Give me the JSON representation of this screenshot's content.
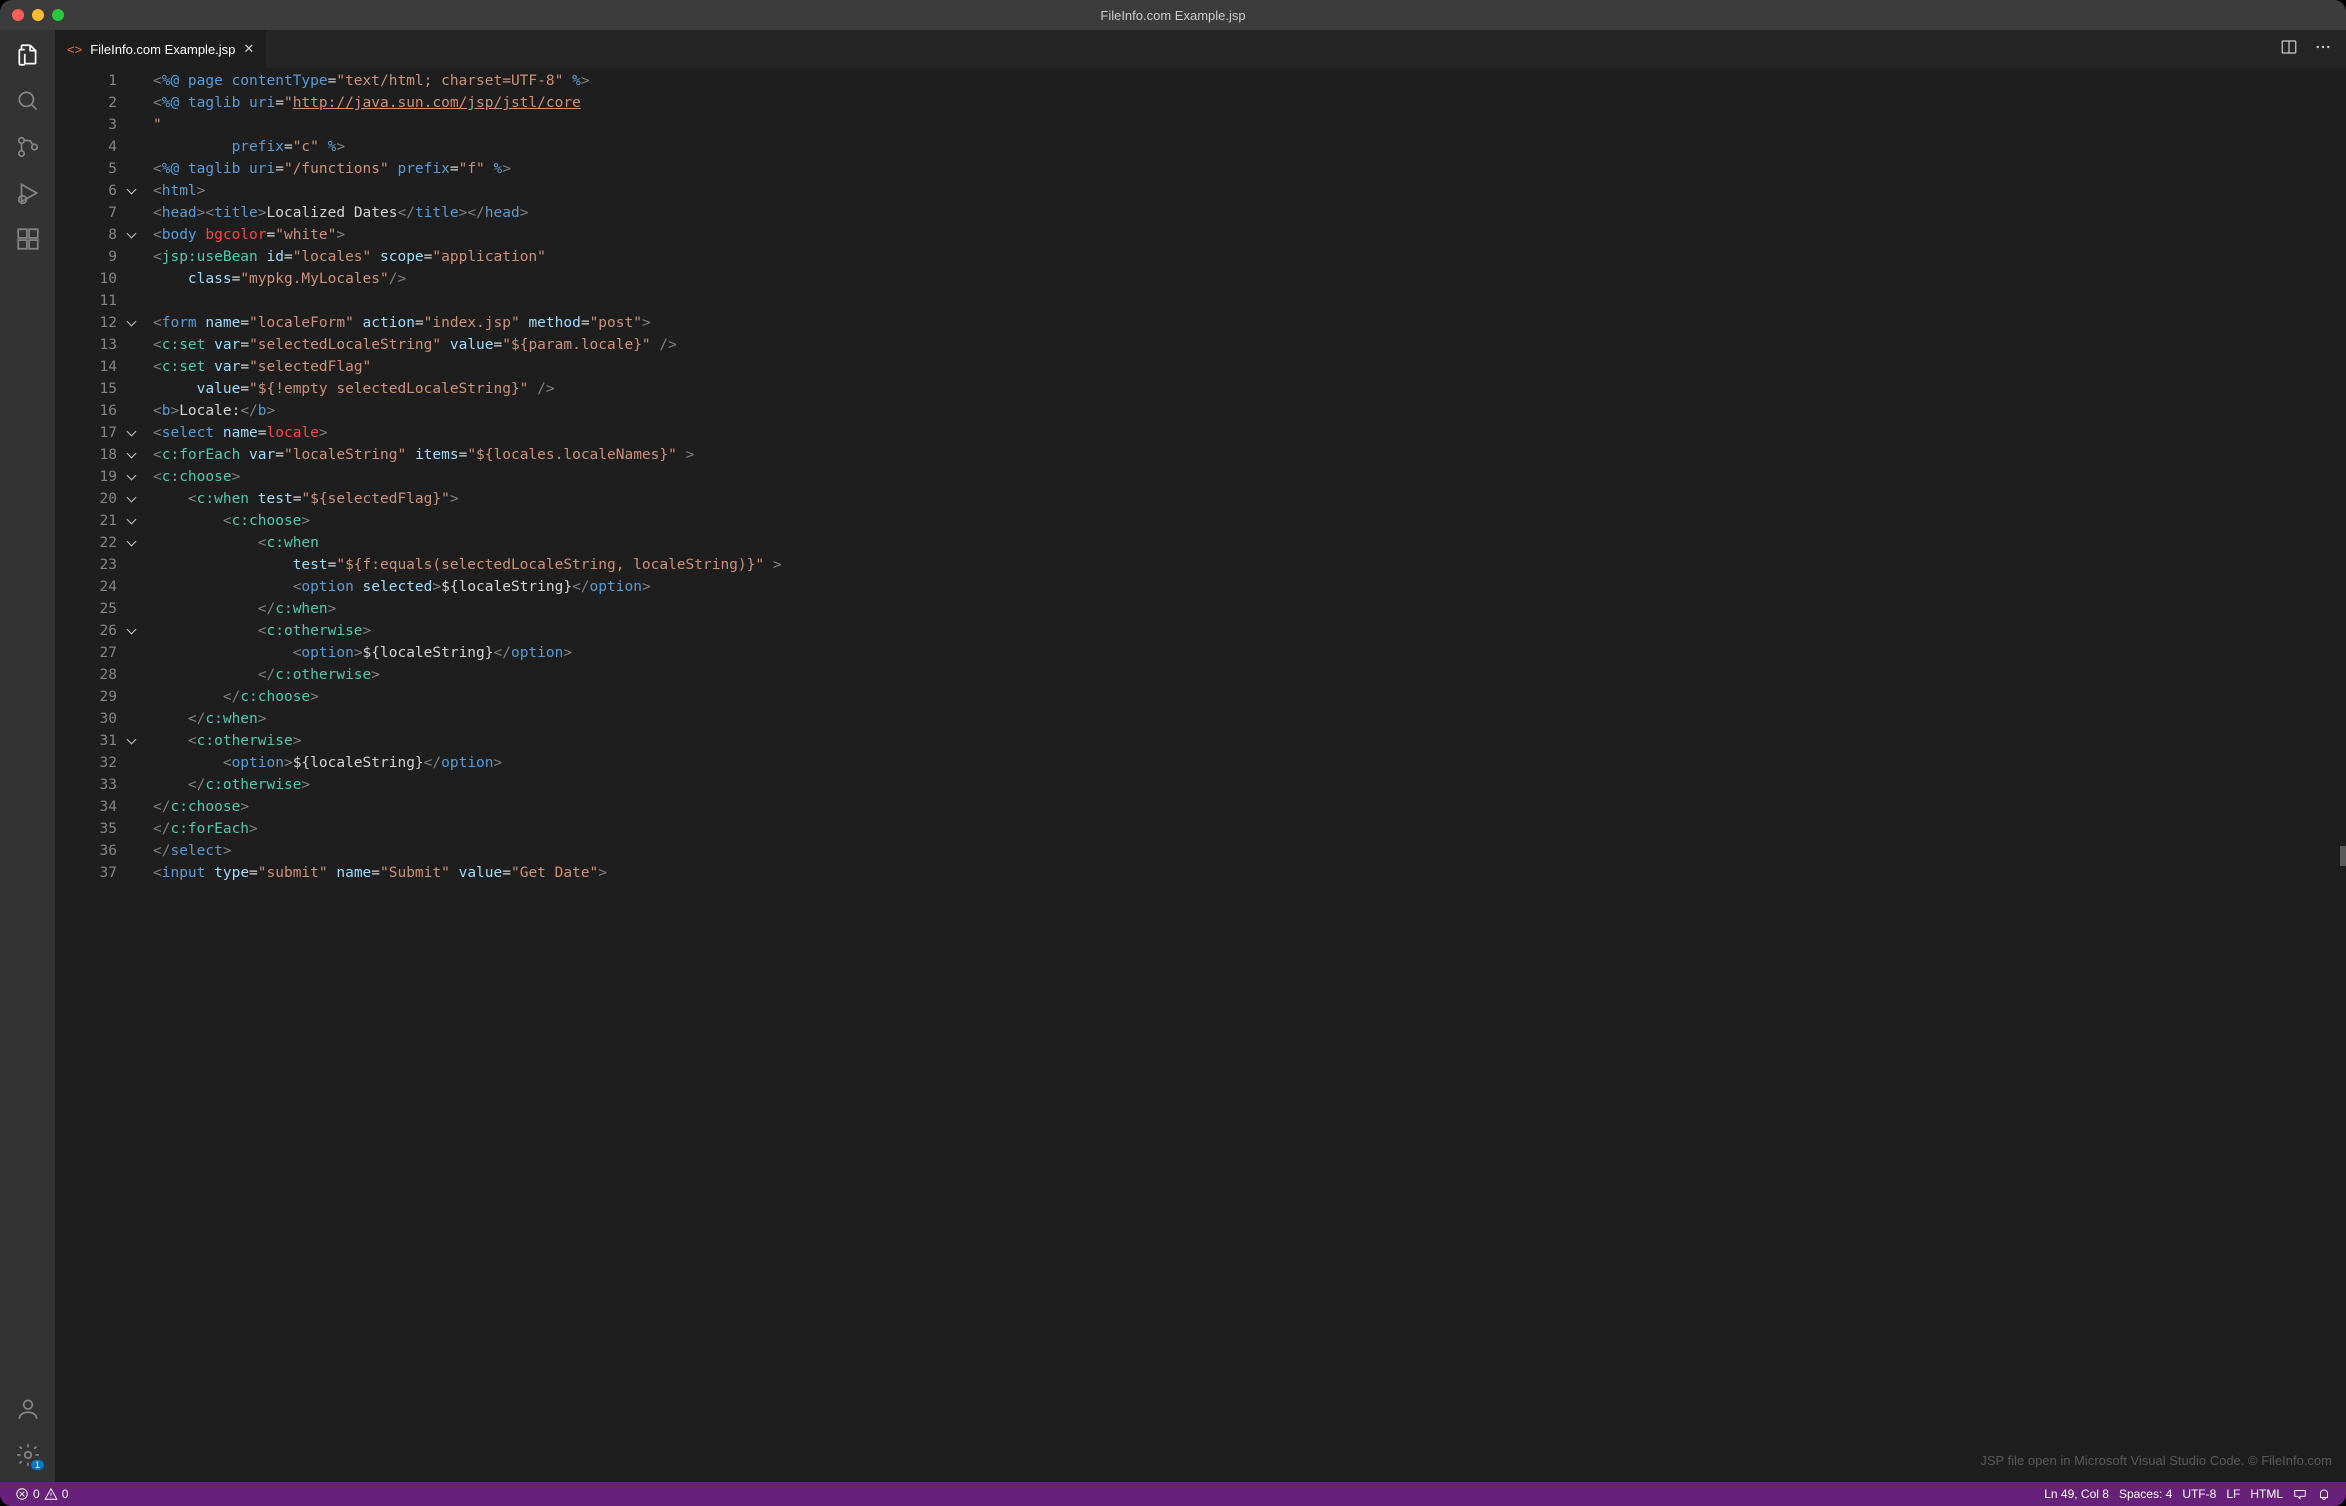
{
  "window": {
    "title": "FileInfo.com Example.jsp"
  },
  "tab": {
    "icon": "<>",
    "label": "FileInfo.com Example.jsp"
  },
  "watermark": "JSP file open in Microsoft Visual Studio Code. © FileInfo.com",
  "status": {
    "errors": "0",
    "warnings": "0",
    "cursor": "Ln 49, Col 8",
    "indent": "Spaces: 4",
    "encoding": "UTF-8",
    "eol": "LF",
    "language": "HTML"
  },
  "settingsBadge": "1",
  "lines": [
    {
      "n": 1,
      "fold": "",
      "html": "<span class='p-gray'>&lt;</span><span class='p-blue'>%@ page contentType</span><span class='p-white'>=</span><span class='p-brown'>\"text/html; charset=UTF-8\"</span> <span class='p-blue'>%</span><span class='p-gray'>&gt;</span>"
    },
    {
      "n": 2,
      "fold": "",
      "html": "<span class='p-gray'>&lt;</span><span class='p-blue'>%@ taglib uri</span><span class='p-white'>=</span><span class='p-brown'>\"<span class='p-under'>http://java.sun.com/jsp/jstl/core</span></span>"
    },
    {
      "n": 3,
      "fold": "",
      "html": "<span class='p-brown'>\"</span>"
    },
    {
      "n": 4,
      "fold": "",
      "html": "         <span class='p-blue'>prefix</span><span class='p-white'>=</span><span class='p-brown'>\"c\"</span> <span class='p-blue'>%</span><span class='p-gray'>&gt;</span>"
    },
    {
      "n": 5,
      "fold": "",
      "html": "<span class='p-gray'>&lt;</span><span class='p-blue'>%@ taglib uri</span><span class='p-white'>=</span><span class='p-brown'>\"/functions\"</span> <span class='p-blue'>prefix</span><span class='p-white'>=</span><span class='p-brown'>\"f\"</span> <span class='p-blue'>%</span><span class='p-gray'>&gt;</span>"
    },
    {
      "n": 6,
      "fold": "v",
      "html": "<span class='p-gray'>&lt;</span><span class='p-blue'>html</span><span class='p-gray'>&gt;</span>"
    },
    {
      "n": 7,
      "fold": "",
      "html": "<span class='p-gray'>&lt;</span><span class='p-blue'>head</span><span class='p-gray'>&gt;&lt;</span><span class='p-blue'>title</span><span class='p-gray'>&gt;</span><span class='p-white'>Localized Dates</span><span class='p-gray'>&lt;/</span><span class='p-blue'>title</span><span class='p-gray'>&gt;&lt;/</span><span class='p-blue'>head</span><span class='p-gray'>&gt;</span>"
    },
    {
      "n": 8,
      "fold": "v",
      "html": "<span class='p-gray'>&lt;</span><span class='p-blue'>body</span> <span class='p-red'>bgcolor</span><span class='p-white'>=</span><span class='p-brown'>\"white\"</span><span class='p-gray'>&gt;</span>"
    },
    {
      "n": 9,
      "fold": "",
      "html": "<span class='p-gray'>&lt;</span><span class='p-teal'>jsp:useBean</span> <span class='p-lightblue'>id</span><span class='p-white'>=</span><span class='p-brown'>\"locales\"</span> <span class='p-lightblue'>scope</span><span class='p-white'>=</span><span class='p-brown'>\"application\"</span>"
    },
    {
      "n": 10,
      "fold": "",
      "html": "    <span class='p-lightblue'>class</span><span class='p-white'>=</span><span class='p-brown'>\"mypkg.MyLocales\"</span><span class='p-gray'>/&gt;</span>"
    },
    {
      "n": 11,
      "fold": "",
      "html": ""
    },
    {
      "n": 12,
      "fold": "v",
      "html": "<span class='p-gray'>&lt;</span><span class='p-blue'>form</span> <span class='p-lightblue'>name</span><span class='p-white'>=</span><span class='p-brown'>\"localeForm\"</span> <span class='p-lightblue'>action</span><span class='p-white'>=</span><span class='p-brown'>\"index.jsp\"</span> <span class='p-lightblue'>method</span><span class='p-white'>=</span><span class='p-brown'>\"post\"</span><span class='p-gray'>&gt;</span>"
    },
    {
      "n": 13,
      "fold": "",
      "html": "<span class='p-gray'>&lt;</span><span class='p-teal'>c:set</span> <span class='p-lightblue'>var</span><span class='p-white'>=</span><span class='p-brown'>\"selectedLocaleString\"</span> <span class='p-lightblue'>value</span><span class='p-white'>=</span><span class='p-brown'>\"${param.locale}\"</span> <span class='p-gray'>/&gt;</span>"
    },
    {
      "n": 14,
      "fold": "",
      "html": "<span class='p-gray'>&lt;</span><span class='p-teal'>c:set</span> <span class='p-lightblue'>var</span><span class='p-white'>=</span><span class='p-brown'>\"selectedFlag\"</span>"
    },
    {
      "n": 15,
      "fold": "",
      "html": "     <span class='p-lightblue'>value</span><span class='p-white'>=</span><span class='p-brown'>\"${!empty selectedLocaleString}\"</span> <span class='p-gray'>/&gt;</span>"
    },
    {
      "n": 16,
      "fold": "",
      "html": "<span class='p-gray'>&lt;</span><span class='p-blue'>b</span><span class='p-gray'>&gt;</span><span class='p-white'>Locale:</span><span class='p-gray'>&lt;/</span><span class='p-blue'>b</span><span class='p-gray'>&gt;</span>"
    },
    {
      "n": 17,
      "fold": "v",
      "html": "<span class='p-gray'>&lt;</span><span class='p-blue'>select</span> <span class='p-lightblue'>name</span><span class='p-white'>=</span><span class='p-red'>locale</span><span class='p-gray'>&gt;</span>"
    },
    {
      "n": 18,
      "fold": "v",
      "html": "<span class='p-gray'>&lt;</span><span class='p-teal'>c:forEach</span> <span class='p-lightblue'>var</span><span class='p-white'>=</span><span class='p-brown'>\"localeString\"</span> <span class='p-lightblue'>items</span><span class='p-white'>=</span><span class='p-brown'>\"${locales.localeNames}\"</span> <span class='p-gray'>&gt;</span>"
    },
    {
      "n": 19,
      "fold": "v",
      "html": "<span class='p-gray'>&lt;</span><span class='p-teal'>c:choose</span><span class='p-gray'>&gt;</span>"
    },
    {
      "n": 20,
      "fold": "v",
      "html": "    <span class='p-gray'>&lt;</span><span class='p-teal'>c:when</span> <span class='p-lightblue'>test</span><span class='p-white'>=</span><span class='p-brown'>\"${selectedFlag}\"</span><span class='p-gray'>&gt;</span>"
    },
    {
      "n": 21,
      "fold": "v",
      "html": "        <span class='p-gray'>&lt;</span><span class='p-teal'>c:choose</span><span class='p-gray'>&gt;</span>"
    },
    {
      "n": 22,
      "fold": "v",
      "html": "            <span class='p-gray'>&lt;</span><span class='p-teal'>c:when</span>"
    },
    {
      "n": 23,
      "fold": "",
      "html": "                <span class='p-lightblue'>test</span><span class='p-white'>=</span><span class='p-brown'>\"${f:equals(selectedLocaleString, localeString)}\"</span> <span class='p-gray'>&gt;</span>"
    },
    {
      "n": 24,
      "fold": "",
      "html": "                <span class='p-gray'>&lt;</span><span class='p-blue'>option</span> <span class='p-lightblue'>selected</span><span class='p-gray'>&gt;</span><span class='p-white'>${localeString}</span><span class='p-gray'>&lt;/</span><span class='p-blue'>option</span><span class='p-gray'>&gt;</span>"
    },
    {
      "n": 25,
      "fold": "",
      "html": "            <span class='p-gray'>&lt;/</span><span class='p-teal'>c:when</span><span class='p-gray'>&gt;</span>"
    },
    {
      "n": 26,
      "fold": "v",
      "html": "            <span class='p-gray'>&lt;</span><span class='p-teal'>c:otherwise</span><span class='p-gray'>&gt;</span>"
    },
    {
      "n": 27,
      "fold": "",
      "html": "                <span class='p-gray'>&lt;</span><span class='p-blue'>option</span><span class='p-gray'>&gt;</span><span class='p-white'>${localeString}</span><span class='p-gray'>&lt;/</span><span class='p-blue'>option</span><span class='p-gray'>&gt;</span>"
    },
    {
      "n": 28,
      "fold": "",
      "html": "            <span class='p-gray'>&lt;/</span><span class='p-teal'>c:otherwise</span><span class='p-gray'>&gt;</span>"
    },
    {
      "n": 29,
      "fold": "",
      "html": "        <span class='p-gray'>&lt;/</span><span class='p-teal'>c:choose</span><span class='p-gray'>&gt;</span>"
    },
    {
      "n": 30,
      "fold": "",
      "html": "    <span class='p-gray'>&lt;/</span><span class='p-teal'>c:when</span><span class='p-gray'>&gt;</span>"
    },
    {
      "n": 31,
      "fold": "v",
      "html": "    <span class='p-gray'>&lt;</span><span class='p-teal'>c:otherwise</span><span class='p-gray'>&gt;</span>"
    },
    {
      "n": 32,
      "fold": "",
      "html": "        <span class='p-gray'>&lt;</span><span class='p-blue'>option</span><span class='p-gray'>&gt;</span><span class='p-white'>${localeString}</span><span class='p-gray'>&lt;/</span><span class='p-blue'>option</span><span class='p-gray'>&gt;</span>"
    },
    {
      "n": 33,
      "fold": "",
      "html": "    <span class='p-gray'>&lt;/</span><span class='p-teal'>c:otherwise</span><span class='p-gray'>&gt;</span>"
    },
    {
      "n": 34,
      "fold": "",
      "html": "<span class='p-gray'>&lt;/</span><span class='p-teal'>c:choose</span><span class='p-gray'>&gt;</span>"
    },
    {
      "n": 35,
      "fold": "",
      "html": "<span class='p-gray'>&lt;/</span><span class='p-teal'>c:forEach</span><span class='p-gray'>&gt;</span>"
    },
    {
      "n": 36,
      "fold": "",
      "html": "<span class='p-gray'>&lt;/</span><span class='p-blue'>select</span><span class='p-gray'>&gt;</span>"
    },
    {
      "n": 37,
      "fold": "",
      "html": "<span class='p-gray'>&lt;</span><span class='p-blue'>input</span> <span class='p-lightblue'>type</span><span class='p-white'>=</span><span class='p-brown'>\"submit\"</span> <span class='p-lightblue'>name</span><span class='p-white'>=</span><span class='p-brown'>\"Submit\"</span> <span class='p-lightblue'>value</span><span class='p-white'>=</span><span class='p-brown'>\"Get Date\"</span><span class='p-gray'>&gt;</span>"
    }
  ]
}
